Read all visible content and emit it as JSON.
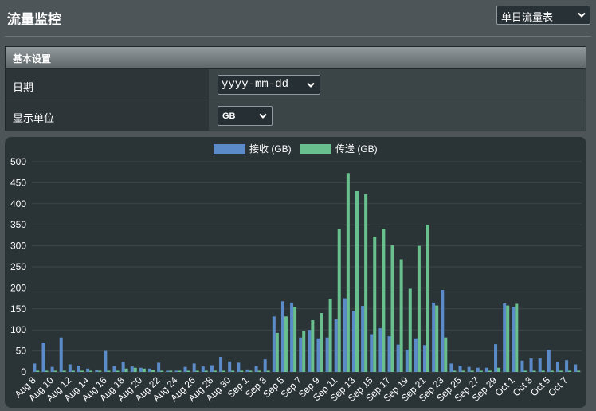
{
  "page": {
    "title": "流量监控"
  },
  "view_select": {
    "value": "单日流量表"
  },
  "settings": {
    "header": "基本设置",
    "date_label": "日期",
    "date_value": "yyyy-mm-dd",
    "unit_label": "显示单位",
    "unit_value": "GB"
  },
  "colors": {
    "received": "#5b8bc9",
    "sent": "#69c08e",
    "panel": "#2a3336",
    "grid": "#3d474b"
  },
  "icons": {
    "dropdown": "chevron-down-icon"
  },
  "chart_data": {
    "type": "bar",
    "title": "",
    "xlabel": "",
    "ylabel": "",
    "ylim": [
      0,
      500
    ],
    "yticks": [
      0,
      50,
      100,
      150,
      200,
      250,
      300,
      350,
      400,
      450,
      500
    ],
    "grid": true,
    "legend_position": "top-center",
    "x_tick_labels": [
      "Aug 8",
      "Aug 10",
      "Aug 12",
      "Aug 14",
      "Aug 16",
      "Aug 18",
      "Aug 20",
      "Aug 22",
      "Aug 24",
      "Aug 26",
      "Aug 28",
      "Aug 30",
      "Sep 1",
      "Sep 3",
      "Sep 5",
      "Sep 7",
      "Sep 9",
      "Sep 11",
      "Sep 13",
      "Sep 15",
      "Sep 17",
      "Sep 19",
      "Sep 21",
      "Sep 23",
      "Sep 25",
      "Sep 27",
      "Sep 29",
      "Oct 1",
      "Oct 3",
      "Oct 5",
      "Oct 7"
    ],
    "categories": [
      "Aug 8",
      "Aug 9",
      "Aug 10",
      "Aug 11",
      "Aug 12",
      "Aug 13",
      "Aug 14",
      "Aug 15",
      "Aug 16",
      "Aug 17",
      "Aug 18",
      "Aug 19",
      "Aug 20",
      "Aug 21",
      "Aug 22",
      "Aug 23",
      "Aug 24",
      "Aug 25",
      "Aug 26",
      "Aug 27",
      "Aug 28",
      "Aug 29",
      "Aug 30",
      "Aug 31",
      "Sep 1",
      "Sep 2",
      "Sep 3",
      "Sep 4",
      "Sep 5",
      "Sep 6",
      "Sep 7",
      "Sep 8",
      "Sep 9",
      "Sep 10",
      "Sep 11",
      "Sep 12",
      "Sep 13",
      "Sep 14",
      "Sep 15",
      "Sep 16",
      "Sep 17",
      "Sep 18",
      "Sep 19",
      "Sep 20",
      "Sep 21",
      "Sep 22",
      "Sep 23",
      "Sep 24",
      "Sep 25",
      "Sep 26",
      "Sep 27",
      "Sep 28",
      "Sep 29",
      "Sep 30",
      "Oct 1",
      "Oct 2",
      "Oct 3",
      "Oct 4",
      "Oct 5",
      "Oct 6",
      "Oct 7",
      "Oct 8"
    ],
    "series": [
      {
        "name": "接收 (GB)",
        "values": [
          20,
          70,
          12,
          82,
          18,
          15,
          8,
          5,
          50,
          14,
          24,
          13,
          10,
          8,
          22,
          3,
          3,
          12,
          20,
          13,
          16,
          36,
          25,
          22,
          6,
          14,
          30,
          132,
          168,
          165,
          82,
          100,
          80,
          82,
          125,
          175,
          145,
          157,
          90,
          104,
          85,
          65,
          53,
          80,
          64,
          165,
          195,
          20,
          15,
          12,
          10,
          10,
          66,
          163,
          155,
          27,
          32,
          32,
          52,
          24,
          28,
          18
        ]
      },
      {
        "name": "传送 (GB)",
        "values": [
          3,
          3,
          3,
          3,
          3,
          3,
          3,
          3,
          3,
          3,
          8,
          10,
          8,
          5,
          3,
          3,
          3,
          3,
          3,
          3,
          3,
          3,
          3,
          3,
          3,
          3,
          3,
          93,
          132,
          155,
          97,
          123,
          140,
          173,
          339,
          473,
          430,
          423,
          322,
          340,
          301,
          268,
          198,
          300,
          350,
          158,
          82,
          3,
          3,
          3,
          3,
          3,
          10,
          158,
          162,
          3,
          3,
          3,
          3,
          3,
          3,
          3
        ]
      }
    ]
  }
}
